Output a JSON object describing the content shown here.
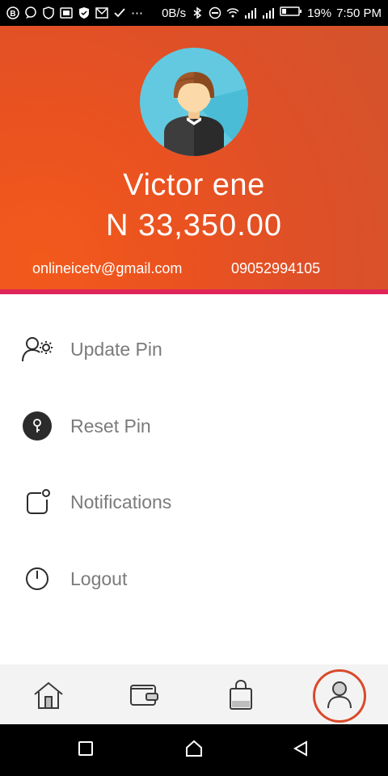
{
  "status_bar": {
    "net_speed": "0B/s",
    "battery_percent": "19%",
    "time": "7:50 PM",
    "icons": [
      "b-circle-icon",
      "chat-bubble-icon",
      "shield-icon",
      "photo-icon",
      "shield-check-icon",
      "mail-icon",
      "check-icon",
      "more-dots-icon",
      "bluetooth-icon",
      "do-not-disturb-icon",
      "wifi-icon",
      "signal-icon",
      "signal-icon",
      "battery-icon"
    ]
  },
  "profile": {
    "name": "Victor ene",
    "balance": "N 33,350.00",
    "email": "onlineicetv@gmail.com",
    "phone": "09052994105"
  },
  "menu": [
    {
      "label": "Update Pin",
      "icon": "user-settings-icon"
    },
    {
      "label": "Reset Pin",
      "icon": "key-circle-icon"
    },
    {
      "label": "Notifications",
      "icon": "notification-icon"
    },
    {
      "label": "Logout",
      "icon": "power-icon"
    }
  ],
  "bottom_nav": {
    "items": [
      "home-icon",
      "wallet-icon",
      "shopping-bag-icon",
      "profile-icon"
    ],
    "active": "profile-icon"
  },
  "colors": {
    "header_orange": "#ea5220",
    "accent_line": "#e0245a",
    "menu_text": "#7b7b7b",
    "nav_bg": "#f3f3f3",
    "active_ring": "#d94a2a"
  }
}
